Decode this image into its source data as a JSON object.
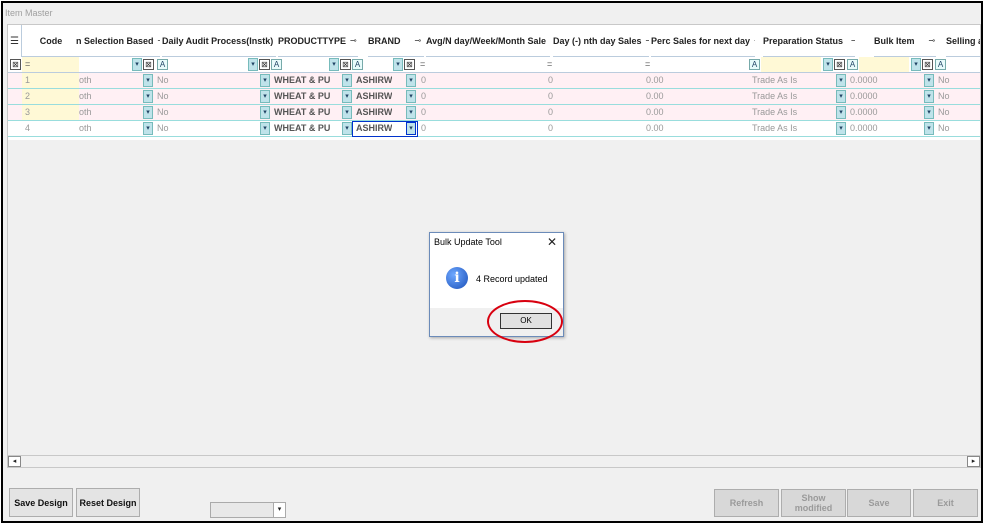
{
  "window": {
    "title": "Item Master"
  },
  "grid": {
    "columns": [
      {
        "label": "Code"
      },
      {
        "label": "n Selection Based"
      },
      {
        "label": "Daily Audit Process(Instk)"
      },
      {
        "label": "PRODUCTTYPE"
      },
      {
        "label": "BRAND"
      },
      {
        "label": "Avg/N day/Week/Month Sale"
      },
      {
        "label": "Day (-) nth day Sales"
      },
      {
        "label": "Perc Sales for next day"
      },
      {
        "label": "Preparation Status"
      },
      {
        "label": "Bulk Item"
      },
      {
        "label": "Selling an"
      }
    ],
    "filter": {
      "eq": "="
    },
    "rows": [
      {
        "num": "1",
        "selection": "oth",
        "audit": "No",
        "ptype": "WHEAT & PU",
        "brand": "ASHIRW",
        "avg": "0",
        "day": "0",
        "perc": "0.00",
        "prep": "Trade As Is",
        "bulk": "0.0000",
        "selling": "No"
      },
      {
        "num": "2",
        "selection": "oth",
        "audit": "No",
        "ptype": "WHEAT & PU",
        "brand": "ASHIRW",
        "avg": "0",
        "day": "0",
        "perc": "0.00",
        "prep": "Trade As Is",
        "bulk": "0.0000",
        "selling": "No"
      },
      {
        "num": "3",
        "selection": "oth",
        "audit": "No",
        "ptype": "WHEAT & PU",
        "brand": "ASHIRW",
        "avg": "0",
        "day": "0",
        "perc": "0.00",
        "prep": "Trade As Is",
        "bulk": "0.0000",
        "selling": "No"
      },
      {
        "num": "4",
        "selection": "oth",
        "audit": "No",
        "ptype": "WHEAT & PU",
        "brand": "ASHIRW",
        "avg": "0",
        "day": "0",
        "perc": "0.00",
        "prep": "Trade As Is",
        "bulk": "0.0000",
        "selling": "No"
      }
    ]
  },
  "buttons": {
    "save_design": "Save Design",
    "reset_design": "Reset Design",
    "refresh": "Refresh",
    "show_modified": "Show modified",
    "save": "Save",
    "exit": "Exit"
  },
  "dialog": {
    "title": "Bulk Update Tool",
    "message": "4 Record updated",
    "ok": "OK",
    "close": "✕"
  },
  "colors": {
    "highlight_ring": "#d8000f",
    "row_pink": "#fff0f4",
    "filter_yellow": "#fff9d6"
  }
}
